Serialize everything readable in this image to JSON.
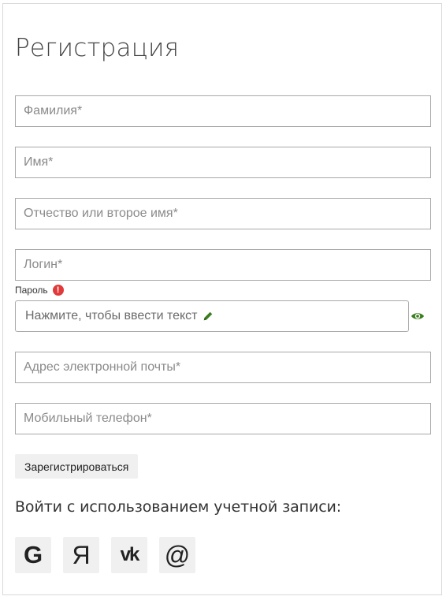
{
  "form": {
    "title": "Регистрация",
    "fields": {
      "last_name_placeholder": "Фамилия*",
      "first_name_placeholder": "Имя*",
      "middle_name_placeholder": "Отчество или второе имя*",
      "login_placeholder": "Логин*",
      "email_placeholder": "Адрес электронной почты*",
      "phone_placeholder": "Мобильный телефон*"
    },
    "password": {
      "label": "Пароль",
      "warning_icon": "!",
      "prompt": "Нажмите, чтобы ввести текст"
    },
    "register_label": "Зарегистрироваться",
    "social_login_text": "Войти с использованием учетной записи:",
    "social": {
      "google": "G",
      "yandex": "Я",
      "vk": "vk",
      "mail": "@"
    }
  },
  "icons": {
    "warning": "warning-icon",
    "pencil": "pencil-icon",
    "eye": "eye-icon",
    "google": "google-icon",
    "yandex": "yandex-icon",
    "vk": "vk-icon",
    "mail": "at-icon"
  },
  "colors": {
    "warning": "#e03a3a",
    "accent_green": "#3a7d1e",
    "border": "#a8a8a8",
    "button_bg": "#f0f0f0"
  }
}
